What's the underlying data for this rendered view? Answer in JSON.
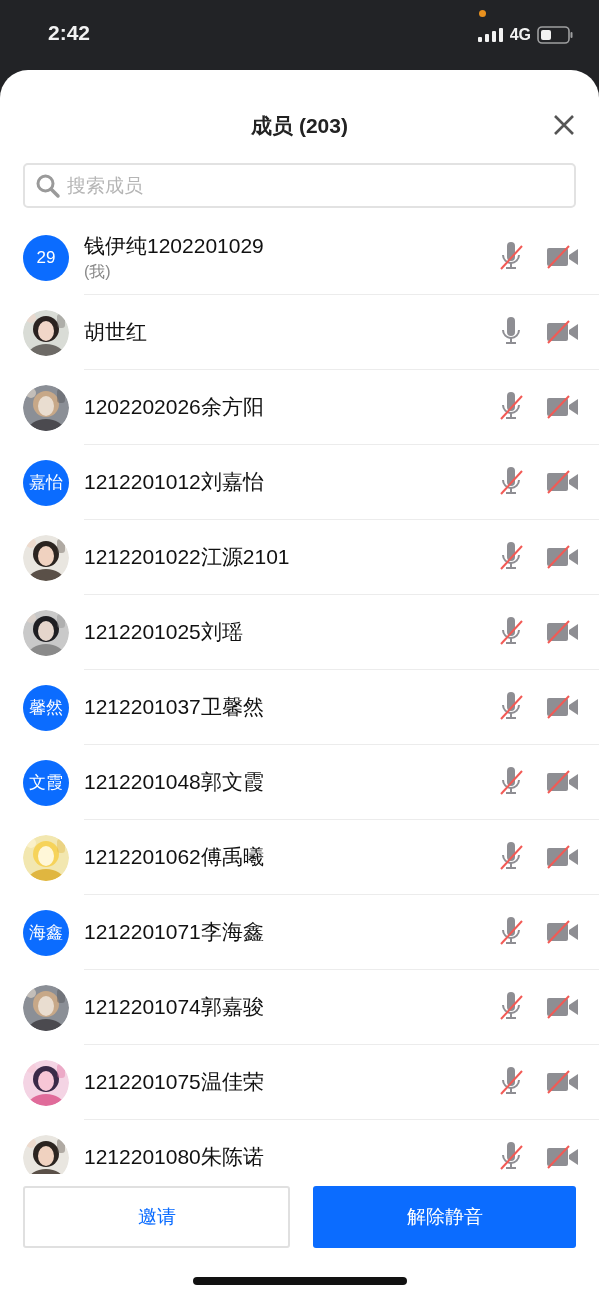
{
  "status_bar": {
    "time": "2:42",
    "network": "4G",
    "recording": true
  },
  "header": {
    "title": "成员 (203)"
  },
  "search": {
    "placeholder": "搜索成员"
  },
  "members": [
    {
      "avatar": {
        "kind": "initials",
        "text": "29"
      },
      "name": "钱伊纯1202201029",
      "note": "(我)",
      "muted": true,
      "video_off": true
    },
    {
      "name": "胡世红",
      "muted": false,
      "video_off": true
    },
    {
      "name": "1202202026余方阳",
      "muted": true,
      "video_off": true
    },
    {
      "avatar": {
        "kind": "initials",
        "text": "嘉怡"
      },
      "name": "1212201012刘嘉怡",
      "muted": true,
      "video_off": true
    },
    {
      "name": "1212201022江源2101",
      "muted": true,
      "video_off": true
    },
    {
      "name": "1212201025刘瑶",
      "muted": true,
      "video_off": true
    },
    {
      "avatar": {
        "kind": "initials",
        "text": "馨然"
      },
      "name": "1212201037卫馨然",
      "muted": true,
      "video_off": true
    },
    {
      "avatar": {
        "kind": "initials",
        "text": "文霞"
      },
      "name": "1212201048郭文霞",
      "muted": true,
      "video_off": true
    },
    {
      "name": "1212201062傅禹曦",
      "muted": true,
      "video_off": true
    },
    {
      "avatar": {
        "kind": "initials",
        "text": "海鑫"
      },
      "name": "1212201071李海鑫",
      "muted": true,
      "video_off": true
    },
    {
      "name": "1212201074郭嘉骏",
      "muted": true,
      "video_off": true
    },
    {
      "name": "1212201075温佳荣",
      "muted": true,
      "video_off": true
    },
    {
      "name": "1212201080朱陈诺",
      "muted": true,
      "video_off": true
    }
  ],
  "buttons": [
    {
      "label": "邀请",
      "kind": "secondary"
    },
    {
      "label": "解除静音",
      "kind": "primary"
    }
  ]
}
